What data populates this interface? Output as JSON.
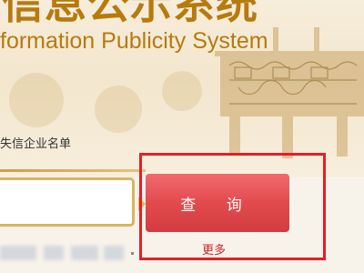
{
  "header": {
    "title_cn": "信息公示系统",
    "title_en": "formation Publicity System"
  },
  "search": {
    "category_label": "失信企业名单",
    "input_value": "",
    "button_label": "查 询",
    "more_link": "更多"
  },
  "colors": {
    "brand_gold": "#b77a0e",
    "button_red": "#e24b4e",
    "highlight_red": "#ea1c24",
    "link_red": "#d0232b"
  },
  "icons": [
    "bronze-vessel-illustration"
  ]
}
